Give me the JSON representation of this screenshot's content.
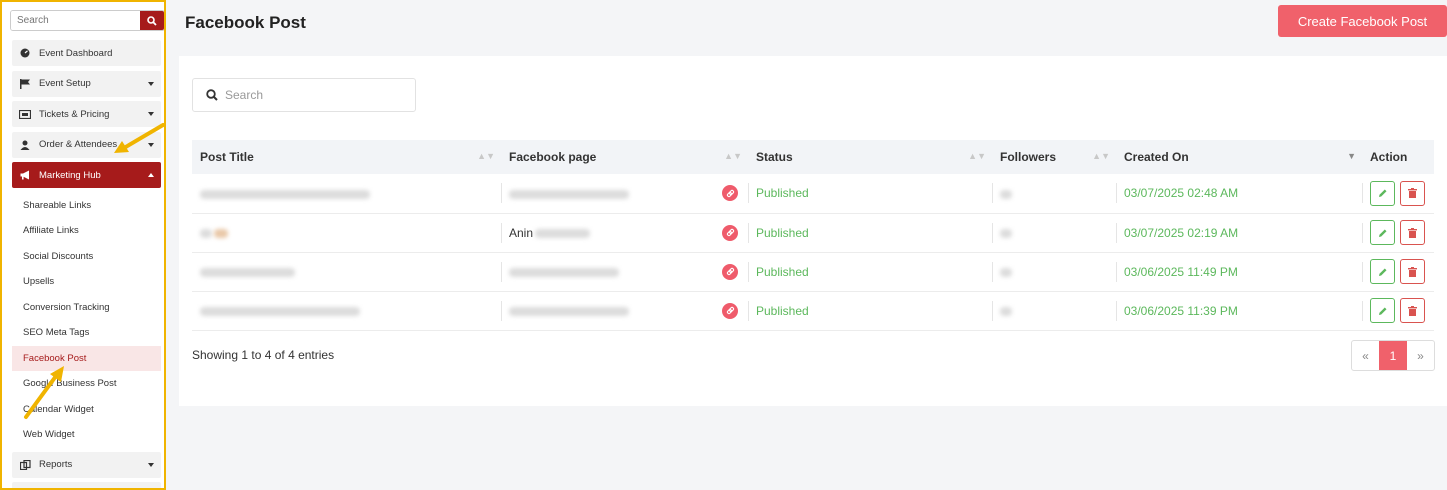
{
  "sidebar": {
    "search_placeholder": "Search",
    "items": [
      {
        "label": "Event Dashboard",
        "icon": "dashboard-icon",
        "has_caret": false
      },
      {
        "label": "Event Setup",
        "icon": "flag-icon",
        "has_caret": true
      },
      {
        "label": "Tickets & Pricing",
        "icon": "ticket-icon",
        "has_caret": true
      },
      {
        "label": "Order & Attendees",
        "icon": "user-icon",
        "has_caret": true
      },
      {
        "label": "Marketing Hub",
        "icon": "megaphone-icon",
        "has_caret": true,
        "active": true
      }
    ],
    "sub_items": [
      "Shareable Links",
      "Affiliate Links",
      "Social Discounts",
      "Upsells",
      "Conversion Tracking",
      "SEO Meta Tags",
      "Facebook Post",
      "Google Business Post",
      "Calendar Widget",
      "Web Widget"
    ],
    "current_sub": "Facebook Post",
    "bottom_items": [
      {
        "label": "Reports",
        "icon": "reports-icon"
      }
    ],
    "accent_color": "#a61b1b",
    "highlight_border": "#f0b400"
  },
  "header": {
    "title": "Facebook Post",
    "create_button": "Create Facebook Post",
    "button_color": "#f0616b"
  },
  "table": {
    "search_placeholder": "Search",
    "columns": [
      "Post Title",
      "Facebook page",
      "Status",
      "Followers",
      "Created On",
      "Action"
    ],
    "rows": [
      {
        "title": "",
        "page": "",
        "status": "Published",
        "followers": "",
        "created": "03/07/2025 02:48 AM"
      },
      {
        "title": "",
        "page": "Anin",
        "status": "Published",
        "followers": "",
        "created": "03/07/2025 02:19 AM"
      },
      {
        "title": "",
        "page": "",
        "status": "Published",
        "followers": "",
        "created": "03/06/2025 11:49 PM"
      },
      {
        "title": "",
        "page": "",
        "status": "Published",
        "followers": "",
        "created": "03/06/2025 11:39 PM"
      }
    ],
    "status_color": "#5cb85c",
    "showing_text": "Showing 1 to 4 of 4 entries",
    "pagination": {
      "prev": "«",
      "current": "1",
      "next": "»"
    }
  }
}
